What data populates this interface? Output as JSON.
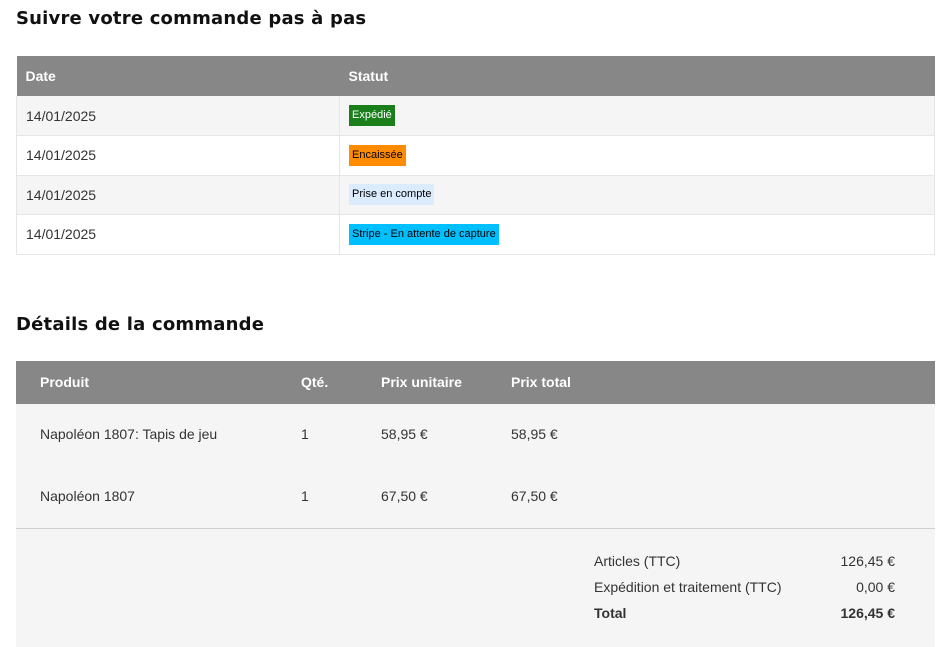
{
  "tracking": {
    "title": "Suivre votre commande pas à pas",
    "headers": {
      "date": "Date",
      "status": "Statut"
    },
    "rows": [
      {
        "date": "14/01/2025",
        "status": "Expédié",
        "badge_bg": "#1a7f1a",
        "badge_fg": "#ffffff"
      },
      {
        "date": "14/01/2025",
        "status": "Encaissée",
        "badge_bg": "#ff8c00",
        "badge_fg": "#000000"
      },
      {
        "date": "14/01/2025",
        "status": "Prise en compte",
        "badge_bg": "#dcecff",
        "badge_fg": "#000000"
      },
      {
        "date": "14/01/2025",
        "status": "Stripe - En attente de capture",
        "badge_bg": "#00bfff",
        "badge_fg": "#000000"
      }
    ]
  },
  "details": {
    "title": "Détails de la commande",
    "headers": {
      "product": "Produit",
      "qty": "Qté.",
      "unit_price": "Prix unitaire",
      "total_price": "Prix total"
    },
    "items": [
      {
        "product": "Napoléon 1807: Tapis de jeu",
        "qty": "1",
        "unit_price": "58,95 €",
        "total_price": "58,95 €"
      },
      {
        "product": "Napoléon 1807",
        "qty": "1",
        "unit_price": "67,50 €",
        "total_price": "67,50 €"
      }
    ],
    "totals": {
      "articles_label": "Articles (TTC)",
      "articles_value": "126,45 €",
      "shipping_label": "Expédition et traitement (TTC)",
      "shipping_value": "0,00 €",
      "total_label": "Total",
      "total_value": "126,45 €"
    }
  }
}
